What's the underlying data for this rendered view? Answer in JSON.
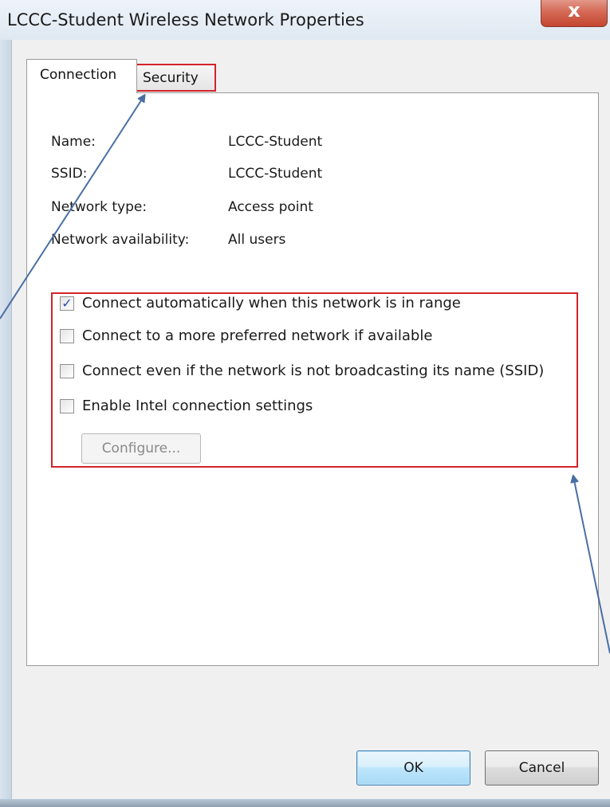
{
  "window": {
    "title": "LCCC-Student Wireless Network Properties",
    "close_label": "x"
  },
  "tabs": [
    {
      "label": "Connection",
      "selected": true
    },
    {
      "label": "Security",
      "selected": false
    }
  ],
  "properties": [
    {
      "label": "Name:",
      "value": "LCCC-Student"
    },
    {
      "label": "SSID:",
      "value": "LCCC-Student"
    },
    {
      "label": "Network type:",
      "value": "Access point"
    },
    {
      "label": "Network availability:",
      "value": "All users"
    }
  ],
  "options": [
    {
      "label": "Connect automatically when this network is in range",
      "checked": true
    },
    {
      "label": "Connect to a more preferred network if available",
      "checked": false
    },
    {
      "label": "Connect even if the network is not broadcasting its name (SSID)",
      "checked": false
    },
    {
      "label": "Enable Intel connection settings",
      "checked": false
    }
  ],
  "configure_button": {
    "label": "Configure...",
    "enabled": false
  },
  "buttons": {
    "ok": "OK",
    "cancel": "Cancel"
  },
  "colors": {
    "highlight": "#d2232a",
    "annotation_arrow": "#4a6fa5"
  }
}
